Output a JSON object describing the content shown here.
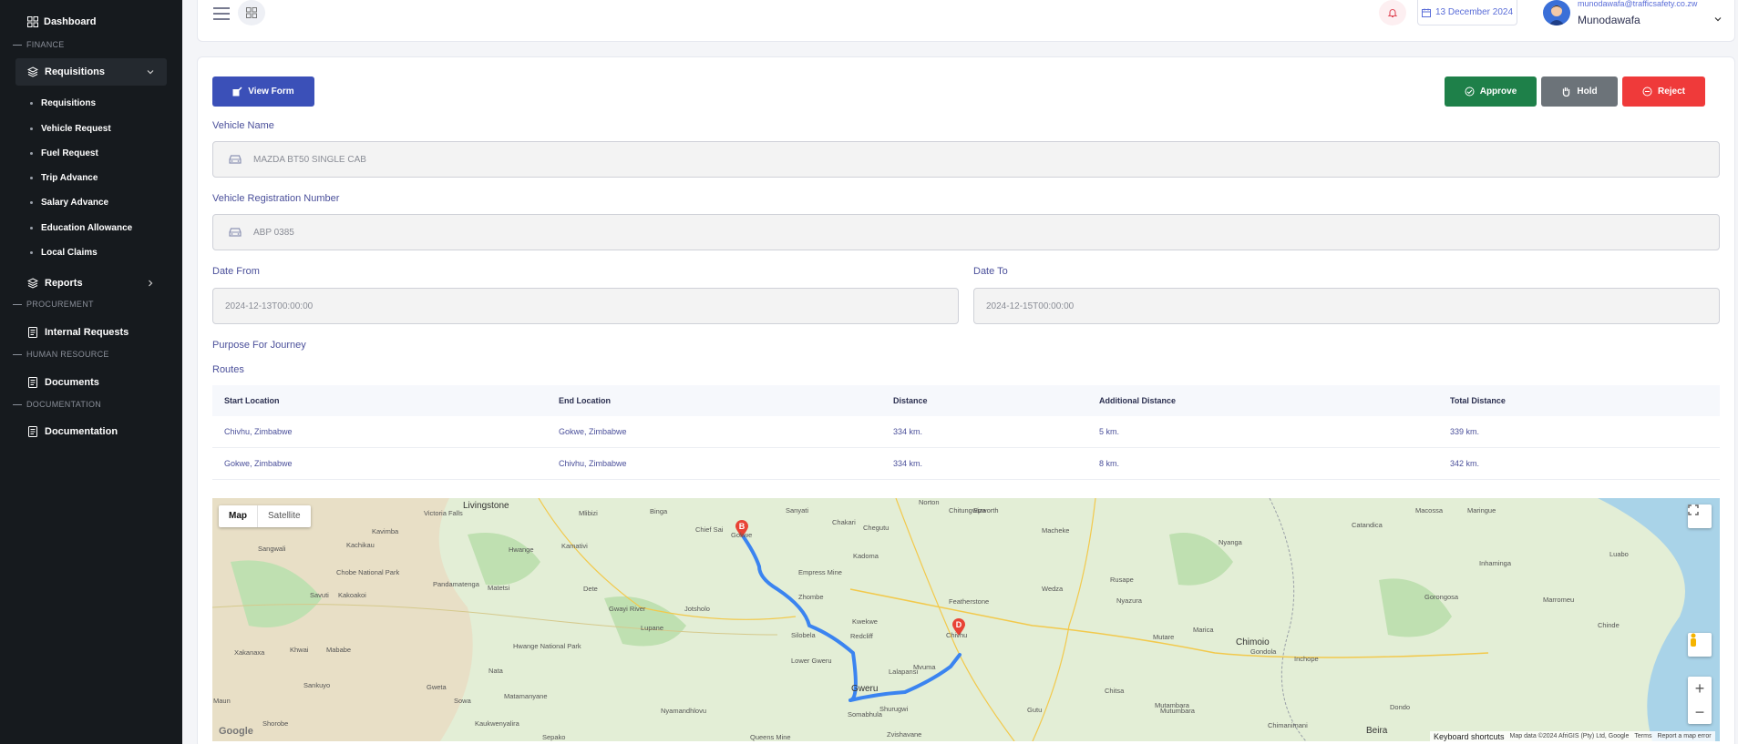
{
  "sidebar": {
    "dashboard": "Dashboard",
    "finance_section": "FINANCE",
    "requisitions_group": "Requisitions",
    "sub_items": [
      "Requisitions",
      "Vehicle Request",
      "Fuel Request",
      "Trip Advance",
      "Salary Advance",
      "Education Allowance",
      "Local Claims"
    ],
    "reports": "Reports",
    "procurement_section": "PROCUREMENT",
    "internal_requests": "Internal Requests",
    "hr_section": "HUMAN RESOURCE",
    "documents": "Documents",
    "documentation_section": "DOCUMENTATION",
    "documentation": "Documentation"
  },
  "topbar": {
    "date": "13 December 2024",
    "user_email": "munodawafa@trafficsafety.co.zw",
    "user_name": "Munodawafa"
  },
  "actions": {
    "view_form": "View Form",
    "approve": "Approve",
    "hold": "Hold",
    "reject": "Reject"
  },
  "form": {
    "vehicle_name_label": "Vehicle Name",
    "vehicle_name_value": "MAZDA BT50 SINGLE CAB",
    "reg_label": "Vehicle Registration Number",
    "reg_value": "ABP 0385",
    "date_from_label": "Date From",
    "date_from_value": "2024-12-13T00:00:00",
    "date_to_label": "Date To",
    "date_to_value": "2024-12-15T00:00:00",
    "purpose_label": "Purpose For Journey",
    "routes_label": "Routes"
  },
  "routes": {
    "headers": [
      "Start Location",
      "End Location",
      "Distance",
      "Additional Distance",
      "Total Distance"
    ],
    "rows": [
      [
        "Chivhu, Zimbabwe",
        "Gokwe, Zimbabwe",
        "334 km.",
        "5 km.",
        "339 km."
      ],
      [
        "Gokwe, Zimbabwe",
        "Chivhu, Zimbabwe",
        "334 km.",
        "8 km.",
        "342 km."
      ]
    ]
  },
  "map": {
    "toggle_map": "Map",
    "toggle_satellite": "Satellite",
    "marker_b": "B",
    "marker_d": "D",
    "google": "Google",
    "keyboard": "Keyboard shortcuts",
    "map_data": "Map data ©2024 AfriGIS (Pty) Ltd, Google",
    "terms": "Terms",
    "report": "Report a map error",
    "places": [
      "Livingstone",
      "Victoria Falls",
      "Kazungula",
      "Hwange",
      "Kamativi",
      "Binga",
      "Mlibizi",
      "Chief Sai",
      "Gokwe",
      "Sanyati",
      "Chakari",
      "Chegutu",
      "Norton",
      "Chitungwiza",
      "Epworth",
      "Macheke",
      "Nyanga",
      "Chimanimani",
      "Empress Mine",
      "Kadoma",
      "Zhombe",
      "Gweru",
      "Kwekwe",
      "Redcliff",
      "Shurugwi",
      "Mvuma",
      "Chivhu",
      "Featherstone",
      "Wedza",
      "Rusape",
      "Nyazura",
      "Mutare",
      "Marica",
      "Chimoio",
      "Gondola",
      "Inchope",
      "Beira",
      "Dondo",
      "Mutambara",
      "Chitsa",
      "Mutumbara",
      "Lalapansi",
      "Silobela",
      "Lower Gweru",
      "Somabhula",
      "Gutu",
      "Zvishavane",
      "Queens Mine",
      "Nyamandhlovu",
      "Lupane",
      "Jotsholo",
      "Gwayi River",
      "Dete",
      "Matetsi",
      "Pandamatenga",
      "Kachikau",
      "Kavimba",
      "Savuti",
      "Kakoakoi",
      "Chobe National Park",
      "Sangwali",
      "Mababe",
      "Khwai",
      "Sankuyo",
      "Xakanaxa",
      "Shorobe",
      "Maun",
      "Sepako",
      "Kaukwenyalira",
      "Matamanyane",
      "Gweta",
      "Nata",
      "Sowa",
      "Hwange National Park",
      "Maringue",
      "Macossa",
      "Catandica",
      "Inhaminga",
      "Gorongosa",
      "Marromeu",
      "Chinde",
      "Luabo"
    ]
  }
}
